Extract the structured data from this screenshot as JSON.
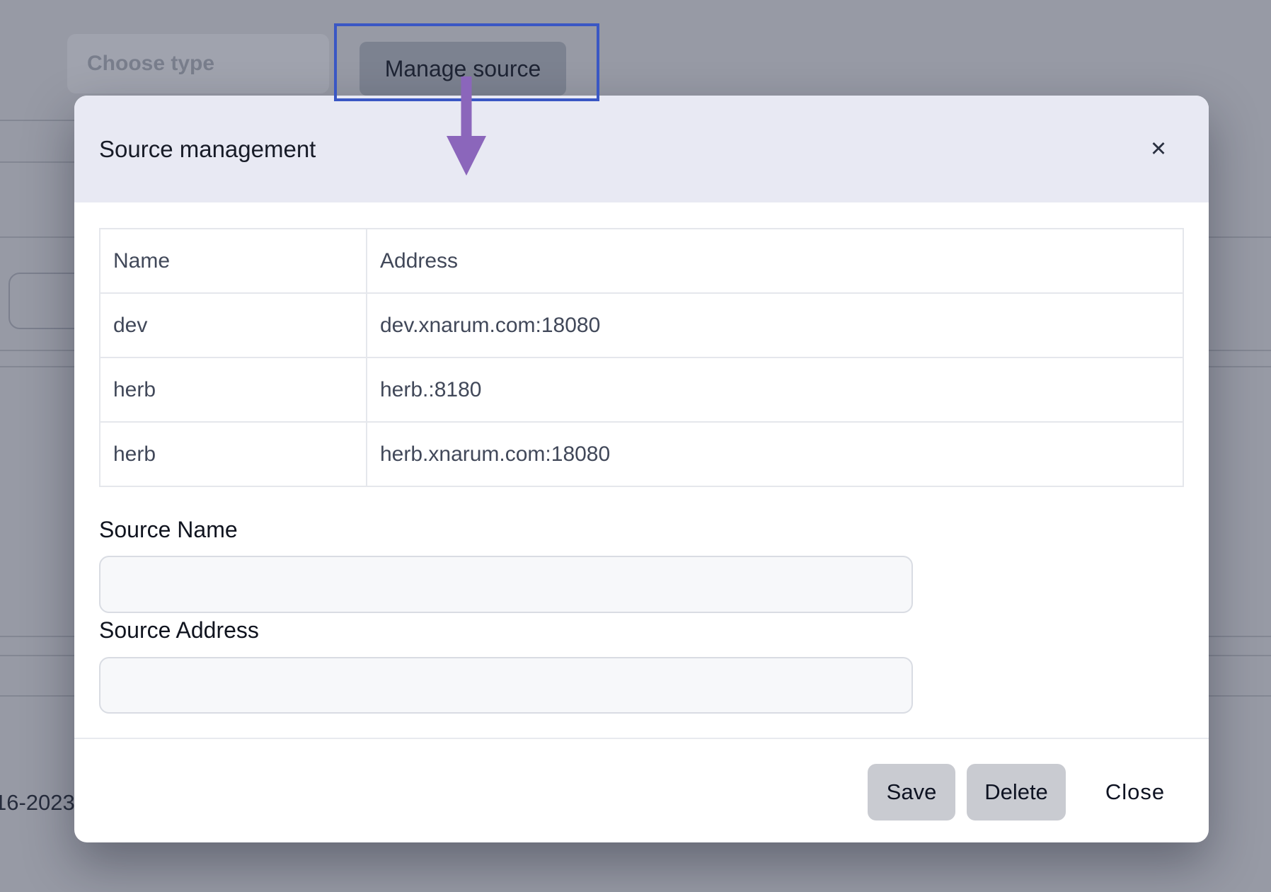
{
  "background": {
    "choose_type_placeholder": "Choose type",
    "manage_source_label": "Manage source",
    "partial_date_text": "16-2023"
  },
  "modal": {
    "title": "Source management",
    "close_icon": "✕",
    "table": {
      "columns": [
        "Name",
        "Address"
      ],
      "rows": [
        {
          "name": "dev",
          "address": "dev.xnarum.com:18080"
        },
        {
          "name": "herb",
          "address": "herb.:8180"
        },
        {
          "name": "herb",
          "address": "herb.xnarum.com:18080"
        }
      ]
    },
    "form": {
      "source_name_label": "Source Name",
      "source_name_value": "",
      "source_address_label": "Source Address",
      "source_address_value": ""
    },
    "footer": {
      "save_label": "Save",
      "delete_label": "Delete",
      "close_label": "Close"
    }
  },
  "annotations": {
    "highlight_box_color": "#3a57c4",
    "arrow_icon": "down-arrow",
    "arrow_color": "#8b66bb"
  },
  "colors": {
    "overlay_background": "#979aa5",
    "modal_header_background": "#e8e9f3",
    "modal_body_background": "#ffffff",
    "table_border": "#e5e7ec",
    "button_background": "#c9cbd1",
    "input_background": "#f7f8fa",
    "input_border": "#d9dce3"
  }
}
